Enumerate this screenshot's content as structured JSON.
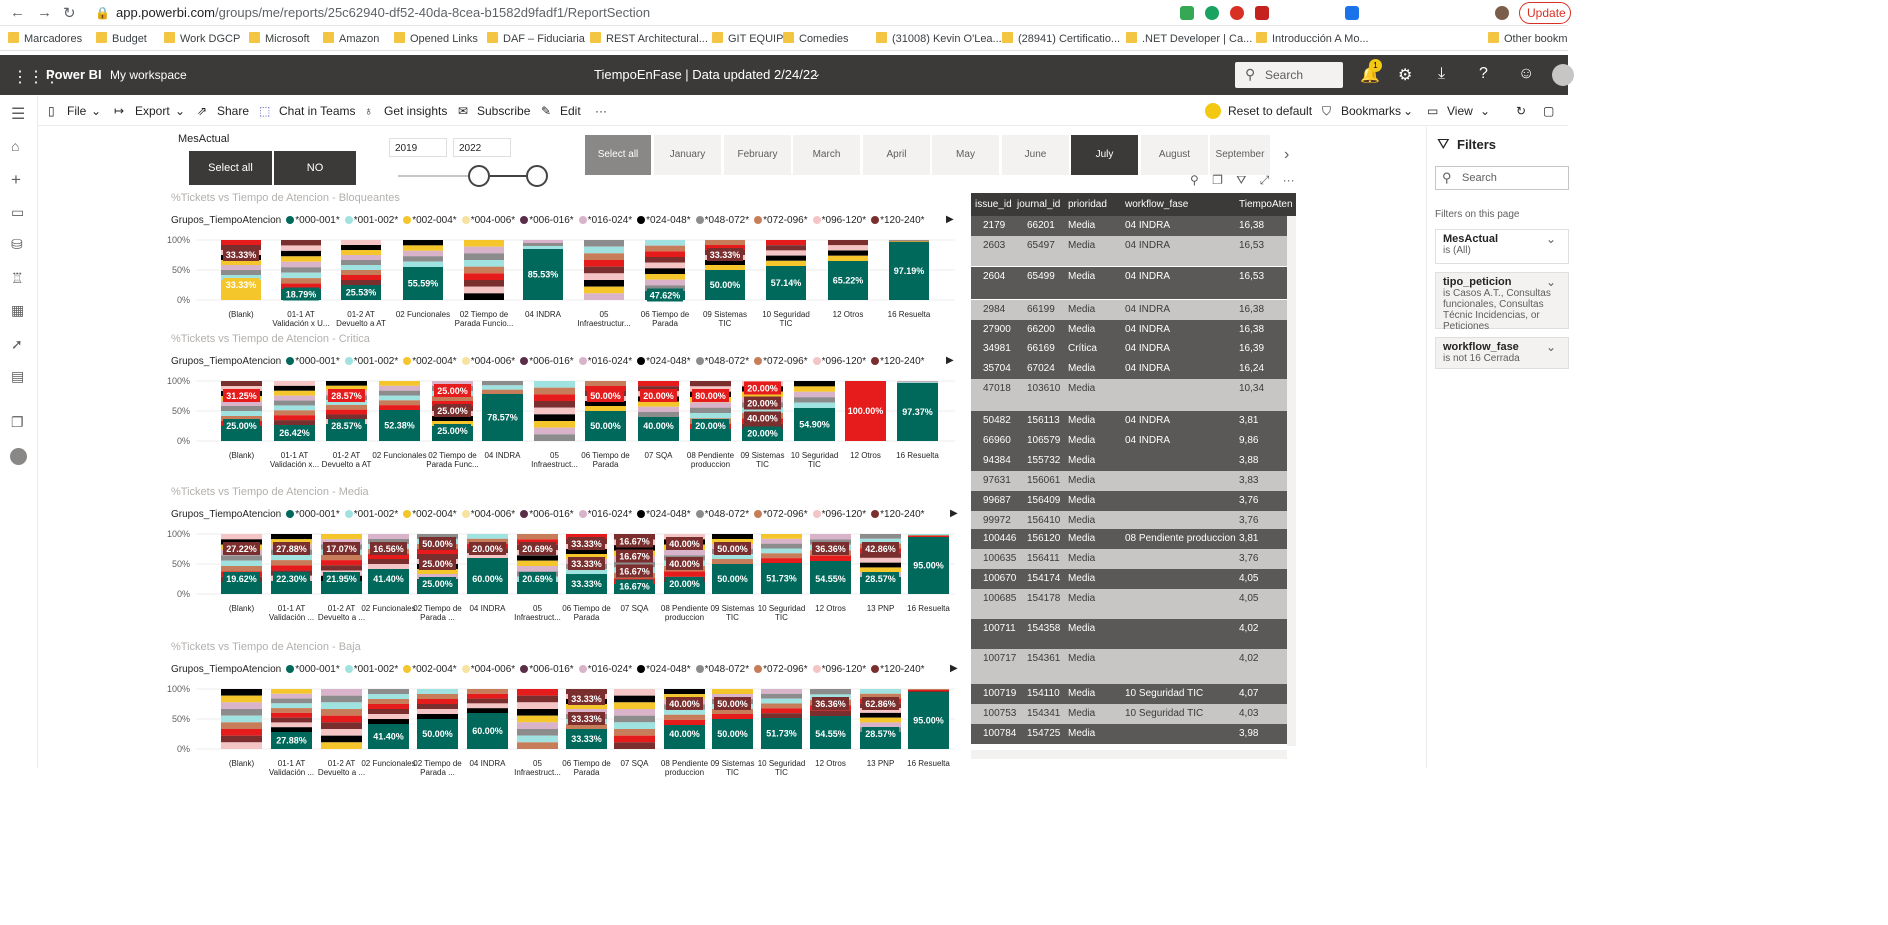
{
  "browser": {
    "url_host": "app.powerbi.com",
    "url_path": "/groups/me/reports/25c62940-df52-40da-8cea-b1582d9fadf1/ReportSection",
    "update_label": "Update",
    "bookmarks": [
      "Marcadores",
      "Budget",
      "Work DGCP",
      "Microsoft",
      "Amazon",
      "Opened Links",
      "DAF – Fiduciaria",
      "REST Architectural...",
      "GIT EQUIPO",
      "Comedies",
      "(31008) Kevin O'Lea...",
      "(28941) Certificatio...",
      ".NET Developer | Ca...",
      "Introducción A Mo...",
      "Other bookm"
    ]
  },
  "header": {
    "brand": "Power BI",
    "workspace": "My workspace",
    "report_title": "TiempoEnFase  |   Data updated 2/24/22",
    "search_placeholder": "Search",
    "notification_count": "1"
  },
  "toolbar": {
    "file": "File",
    "export": "Export",
    "share": "Share",
    "chat": "Chat in Teams",
    "insights": "Get insights",
    "subscribe": "Subscribe",
    "edit": "Edit",
    "more": "···",
    "reset": "Reset to default",
    "bookmarks": "Bookmarks",
    "view": "View"
  },
  "slicers": {
    "mes_label": "MesActual",
    "select_all": "Select all",
    "no": "NO",
    "year_from": "2019",
    "year_to": "2022",
    "months": [
      "Select all",
      "January",
      "February",
      "March",
      "April",
      "May",
      "June",
      "July",
      "August",
      "September"
    ],
    "selected_month": "July"
  },
  "charts": [
    {
      "title": "%Tickets vs Tiempo de Atencion - Bloqueantes"
    },
    {
      "title": "%Tickets vs Tiempo de Atencion - Critica"
    },
    {
      "title": "%Tickets vs Tiempo de Atencion - Media"
    },
    {
      "title": "%Tickets vs Tiempo de Atencion - Baja"
    }
  ],
  "legend": {
    "title": "Grupos_TiempoAtencion",
    "items": [
      "*000-001*",
      "*001-002*",
      "*002-004*",
      "*004-006*",
      "*006-016*",
      "*016-024*",
      "*024-048*",
      "*048-072*",
      "*072-096*",
      "*096-120*",
      "*120-240*"
    ],
    "colors": [
      "#00695c",
      "#9fe2df",
      "#f5c62b",
      "#f8e29f",
      "#5a2e48",
      "#d9b3c9",
      "#000000",
      "#8c8c8c",
      "#c77d59",
      "#f5c4c4",
      "#7a2e2e"
    ]
  },
  "chart_data": [
    {
      "type": "bar",
      "title": "%Tickets vs Tiempo de Atencion - Bloqueantes",
      "categories": [
        "(Blank)",
        "01-1 AT Validación x U...",
        "01-2 AT Devuelto a AT",
        "02 Funcionales",
        "02 Tiempo de Parada Funcio...",
        "04 INDRA",
        "05 Infraestructur...",
        "06 Tiempo de Parada",
        "09 Sistemas TIC",
        "10 Seguridad TIC",
        "12 Otros",
        "16 Resuelta"
      ],
      "labels": [
        [
          "33.33%",
          "33.33%"
        ],
        [
          "18.79%"
        ],
        [
          "25.53%"
        ],
        [
          "55.59%"
        ],
        [],
        [
          "85.53%"
        ],
        [],
        [
          "47.62%"
        ],
        [
          "33.33%",
          "50.00%"
        ],
        [
          "57.14%"
        ],
        [
          "65.22%"
        ],
        [
          "97.19%"
        ]
      ],
      "yticks": [
        "100%",
        "50%",
        "0%"
      ]
    },
    {
      "type": "bar",
      "title": "%Tickets vs Tiempo de Atencion - Critica",
      "categories": [
        "(Blank)",
        "01-1 AT Validación x...",
        "01-2 AT Devuelto a AT",
        "02 Funcionales",
        "02 Tiempo de Parada Func...",
        "04 INDRA",
        "05 Infraestruct...",
        "06 Tiempo de Parada",
        "07 SQA",
        "08 Pendiente produccion",
        "09 Sistemas TIC",
        "10 Seguridad TIC",
        "12 Otros",
        "16 Resuelta"
      ],
      "labels": [
        [
          "31.25%",
          "25.00%"
        ],
        [
          "26.42%"
        ],
        [
          "28.57%",
          "28.57%"
        ],
        [
          "52.38%"
        ],
        [
          "25.00%",
          "25.00%",
          "25.00%"
        ],
        [
          "78.57%"
        ],
        [],
        [
          "50.00%",
          "50.00%"
        ],
        [
          "20.00%",
          "40.00%"
        ],
        [
          "80.00%",
          "20.00%"
        ],
        [
          "20.00%",
          "20.00%",
          "40.00%",
          "20.00%"
        ],
        [
          "54.90%"
        ],
        [
          "100.00%"
        ],
        [
          "97.37%"
        ]
      ],
      "yticks": [
        "100%",
        "50%",
        "0%"
      ]
    },
    {
      "type": "bar",
      "title": "%Tickets vs Tiempo de Atencion - Media",
      "categories": [
        "(Blank)",
        "01-1 AT Validación ...",
        "01-2 AT Devuelto a ...",
        "02 Funcionales",
        "02 Tiempo de Parada ...",
        "04 INDRA",
        "05 Infraestruct...",
        "06 Tiempo de Parada",
        "07 SQA",
        "08 Pendiente produccion",
        "09 Sistemas TIC",
        "10 Seguridad TIC",
        "12 Otros",
        "13 PNP",
        "16 Resuelta"
      ],
      "labels": [
        [
          "27.22%",
          "19.62%"
        ],
        [
          "27.88%",
          "22.30%"
        ],
        [
          "17.07%",
          "21.95%"
        ],
        [
          "16.56%",
          "41.40%"
        ],
        [
          "50.00%",
          "25.00%",
          "25.00%"
        ],
        [
          "20.00%",
          "60.00%"
        ],
        [
          "20.69%",
          "20.69%"
        ],
        [
          "33.33%",
          "33.33%",
          "33.33%"
        ],
        [
          "16.67%",
          "16.67%",
          "16.67%",
          "16.67%"
        ],
        [
          "40.00%",
          "40.00%",
          "20.00%"
        ],
        [
          "50.00%",
          "50.00%"
        ],
        [
          "51.73%"
        ],
        [
          "36.36%",
          "54.55%"
        ],
        [
          "42.86%",
          "28.57%"
        ],
        [
          "95.00%"
        ]
      ],
      "yticks": [
        "100%",
        "50%",
        "0%"
      ]
    },
    {
      "type": "bar",
      "title": "%Tickets vs Tiempo de Atencion - Baja",
      "categories": [
        "(Blank)",
        "01-1 AT Validación ...",
        "01-2 AT Devuelto a ...",
        "02 Funcionales",
        "02 Tiempo de Parada ...",
        "04 INDRA",
        "05 Infraestruct...",
        "06 Tiempo de Parada",
        "07 SQA",
        "08 Pendiente produccion",
        "09 Sistemas TIC",
        "10 Seguridad TIC",
        "12 Otros",
        "13 PNP",
        "16 Resuelta"
      ],
      "labels": [
        [],
        [
          "27.88%"
        ],
        [],
        [
          "41.40%"
        ],
        [
          "50.00%"
        ],
        [
          "60.00%"
        ],
        [],
        [
          "33.33%",
          "33.33%",
          "33.33%"
        ],
        [],
        [
          "40.00%",
          "40.00%"
        ],
        [
          "50.00%",
          "50.00%"
        ],
        [
          "51.73%"
        ],
        [
          "36.36%",
          "54.55%"
        ],
        [
          "62.86%",
          "28.57%"
        ],
        [
          "95.00%"
        ]
      ],
      "yticks": [
        "100%",
        "50%",
        "0%"
      ]
    }
  ],
  "table": {
    "columns": [
      "issue_id",
      "journal_id",
      "prioridad",
      "workflow_fase",
      "TiempoAten"
    ],
    "rows": [
      [
        "2179",
        "66201",
        "Media",
        "04 INDRA",
        "16,38"
      ],
      [
        "2603",
        "65497",
        "Media",
        "04 INDRA",
        "16,53"
      ],
      [
        "2604",
        "65499",
        "Media",
        "04 INDRA",
        "16,53"
      ],
      [
        "2984",
        "66199",
        "Media",
        "04 INDRA",
        "16,38"
      ],
      [
        "27900",
        "66200",
        "Media",
        "04 INDRA",
        "16,38"
      ],
      [
        "34981",
        "66169",
        "Crítica",
        "04 INDRA",
        "16,39"
      ],
      [
        "35704",
        "67024",
        "Media",
        "04 INDRA",
        "16,24"
      ],
      [
        "47018",
        "103610",
        "Media",
        "",
        "10,34"
      ],
      [
        "50482",
        "156113",
        "Media",
        "04 INDRA",
        "3,81"
      ],
      [
        "66960",
        "106579",
        "Media",
        "04 INDRA",
        "9,86"
      ],
      [
        "94384",
        "155732",
        "Media",
        "",
        "3,88"
      ],
      [
        "97631",
        "156061",
        "Media",
        "",
        "3,83"
      ],
      [
        "99687",
        "156409",
        "Media",
        "",
        "3,76"
      ],
      [
        "99972",
        "156410",
        "Media",
        "",
        "3,76"
      ],
      [
        "100446",
        "156120",
        "Media",
        "08 Pendiente produccion",
        "3,81"
      ],
      [
        "100635",
        "156411",
        "Media",
        "",
        "3,76"
      ],
      [
        "100670",
        "154174",
        "Media",
        "",
        "4,05"
      ],
      [
        "100685",
        "154178",
        "Media",
        "",
        "4,05"
      ],
      [
        "100711",
        "154358",
        "Media",
        "",
        "4,02"
      ],
      [
        "100717",
        "154361",
        "Media",
        "",
        "4,02"
      ],
      [
        "100719",
        "154110",
        "Media",
        "10 Seguridad TIC",
        "4,07"
      ],
      [
        "100753",
        "154341",
        "Media",
        "10 Seguridad TIC",
        "4,03"
      ],
      [
        "100784",
        "154725",
        "Media",
        "",
        "3,98"
      ]
    ]
  },
  "filters": {
    "title": "Filters",
    "search_placeholder": "Search",
    "section": "Filters on this page",
    "cards": [
      {
        "name": "MesActual",
        "value": "is (All)"
      },
      {
        "name": "tipo_peticion",
        "value": "is Casos A.T., Consultas funcionales, Consultas Técnic Incidencias, or Peticiones"
      },
      {
        "name": "workflow_fase",
        "value": "is not 16 Cerrada"
      }
    ]
  }
}
